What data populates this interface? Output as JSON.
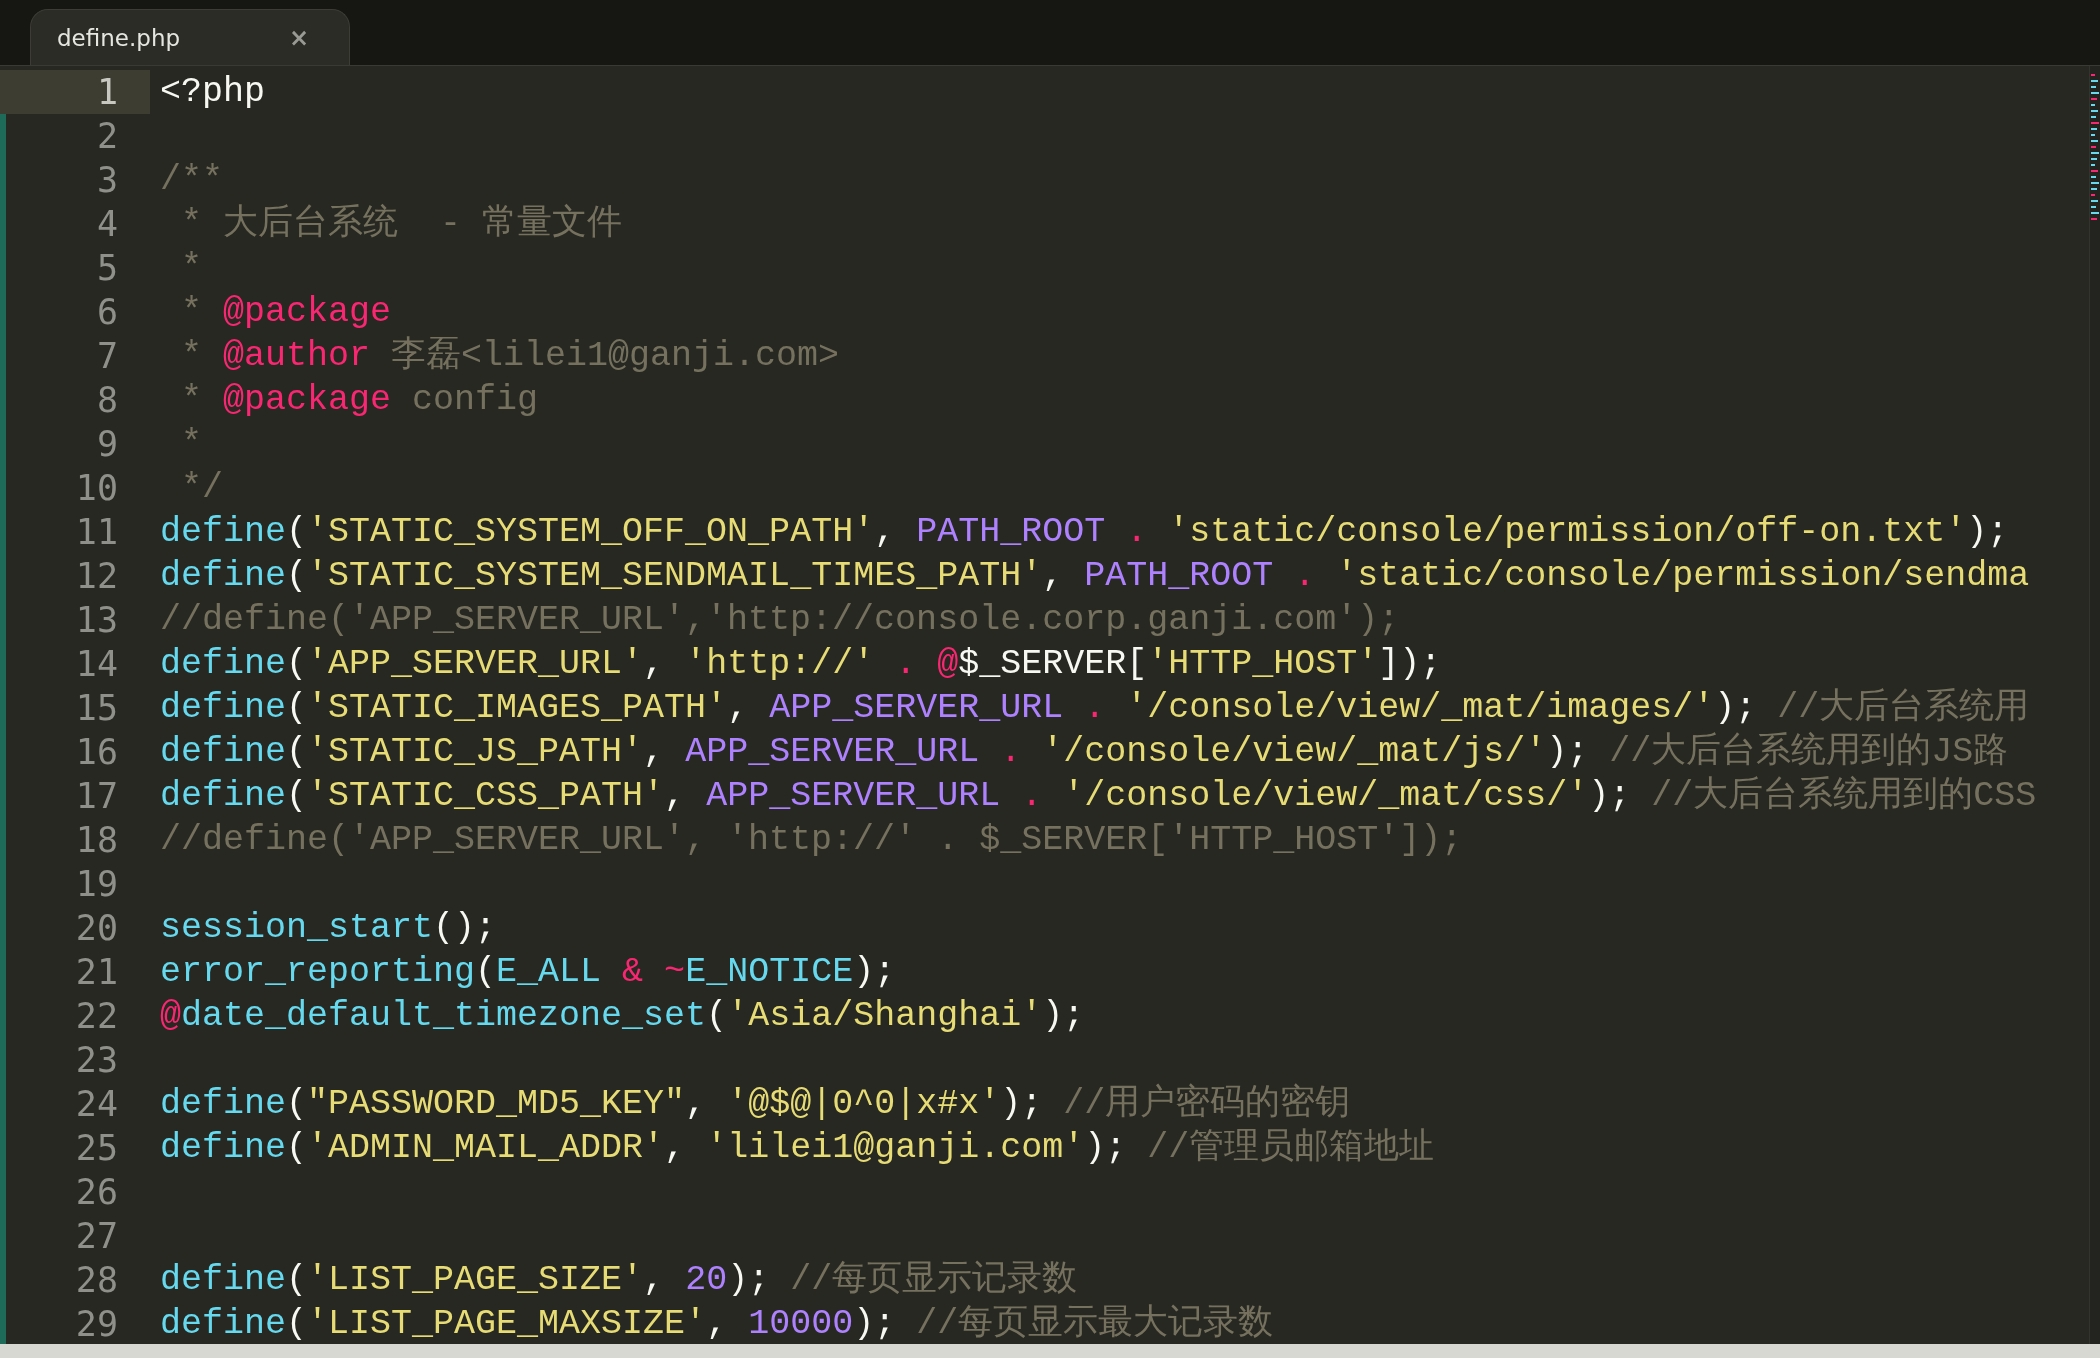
{
  "tab": {
    "title": "define.php",
    "close": "×",
    "selected": true
  },
  "lines": [
    {
      "number": "1",
      "current": true,
      "tokens": [
        {
          "kind": "plain",
          "text": "<?php"
        }
      ]
    },
    {
      "number": "2",
      "current": false
    },
    {
      "number": "3",
      "current": false,
      "tokens": [
        {
          "kind": "comment",
          "text": "/**"
        }
      ]
    },
    {
      "number": "4",
      "current": false,
      "tokens": [
        {
          "kind": "comment",
          "text": " * 大后台系统  - 常量文件"
        }
      ]
    },
    {
      "number": "5",
      "current": false,
      "tokens": [
        {
          "kind": "comment",
          "text": " *"
        }
      ]
    },
    {
      "number": "6",
      "current": false,
      "tokens": [
        {
          "kind": "comment",
          "text": " * "
        },
        {
          "kind": "operator",
          "text": "@package"
        }
      ]
    },
    {
      "number": "7",
      "current": false,
      "tokens": [
        {
          "kind": "comment",
          "text": " * "
        },
        {
          "kind": "operator",
          "text": "@author"
        },
        {
          "kind": "comment",
          "text": " 李磊<lilei1@ganji.com>"
        }
      ]
    },
    {
      "number": "8",
      "current": false,
      "tokens": [
        {
          "kind": "comment",
          "text": " * "
        },
        {
          "kind": "operator",
          "text": "@package"
        },
        {
          "kind": "comment",
          "text": " config"
        }
      ]
    },
    {
      "number": "9",
      "current": false,
      "tokens": [
        {
          "kind": "comment",
          "text": " *"
        }
      ]
    },
    {
      "number": "10",
      "current": false,
      "tokens": [
        {
          "kind": "comment",
          "text": " */"
        }
      ]
    },
    {
      "number": "11",
      "current": false,
      "tokens": [
        {
          "kind": "function",
          "text": "define"
        },
        {
          "kind": "plain",
          "text": "("
        },
        {
          "kind": "string",
          "text": "'STATIC_SYSTEM_OFF_ON_PATH'"
        },
        {
          "kind": "plain",
          "text": ", "
        },
        {
          "kind": "constant",
          "text": "PATH_ROOT"
        },
        {
          "kind": "operator",
          "text": " . "
        },
        {
          "kind": "string",
          "text": "'static/console/permission/off-on.txt'"
        },
        {
          "kind": "plain",
          "text": ");"
        }
      ]
    },
    {
      "number": "12",
      "current": false,
      "tokens": [
        {
          "kind": "function",
          "text": "define"
        },
        {
          "kind": "plain",
          "text": "("
        },
        {
          "kind": "string",
          "text": "'STATIC_SYSTEM_SENDMAIL_TIMES_PATH'"
        },
        {
          "kind": "plain",
          "text": ", "
        },
        {
          "kind": "constant",
          "text": "PATH_ROOT"
        },
        {
          "kind": "operator",
          "text": " . "
        },
        {
          "kind": "string",
          "text": "'static/console/permission/sendma"
        }
      ]
    },
    {
      "number": "13",
      "current": false,
      "tokens": [
        {
          "kind": "comment",
          "text": "//define('APP_SERVER_URL','http://console.corp.ganji.com');"
        }
      ]
    },
    {
      "number": "14",
      "current": false,
      "tokens": [
        {
          "kind": "function",
          "text": "define"
        },
        {
          "kind": "plain",
          "text": "("
        },
        {
          "kind": "string",
          "text": "'APP_SERVER_URL'"
        },
        {
          "kind": "plain",
          "text": ", "
        },
        {
          "kind": "string",
          "text": "'http://'"
        },
        {
          "kind": "operator",
          "text": " . @"
        },
        {
          "kind": "plain",
          "text": "$_SERVER["
        },
        {
          "kind": "string",
          "text": "'HTTP_HOST'"
        },
        {
          "kind": "plain",
          "text": "]);"
        }
      ]
    },
    {
      "number": "15",
      "current": false,
      "tokens": [
        {
          "kind": "function",
          "text": "define"
        },
        {
          "kind": "plain",
          "text": "("
        },
        {
          "kind": "string",
          "text": "'STATIC_IMAGES_PATH'"
        },
        {
          "kind": "plain",
          "text": ", "
        },
        {
          "kind": "constant",
          "text": "APP_SERVER_URL"
        },
        {
          "kind": "operator",
          "text": " . "
        },
        {
          "kind": "string",
          "text": "'/console/view/_mat/images/'"
        },
        {
          "kind": "plain",
          "text": "); "
        },
        {
          "kind": "comment",
          "text": "//大后台系统用"
        }
      ]
    },
    {
      "number": "16",
      "current": false,
      "tokens": [
        {
          "kind": "function",
          "text": "define"
        },
        {
          "kind": "plain",
          "text": "("
        },
        {
          "kind": "string",
          "text": "'STATIC_JS_PATH'"
        },
        {
          "kind": "plain",
          "text": ", "
        },
        {
          "kind": "constant",
          "text": "APP_SERVER_URL"
        },
        {
          "kind": "operator",
          "text": " . "
        },
        {
          "kind": "string",
          "text": "'/console/view/_mat/js/'"
        },
        {
          "kind": "plain",
          "text": "); "
        },
        {
          "kind": "comment",
          "text": "//大后台系统用到的JS路"
        }
      ]
    },
    {
      "number": "17",
      "current": false,
      "tokens": [
        {
          "kind": "function",
          "text": "define"
        },
        {
          "kind": "plain",
          "text": "("
        },
        {
          "kind": "string",
          "text": "'STATIC_CSS_PATH'"
        },
        {
          "kind": "plain",
          "text": ", "
        },
        {
          "kind": "constant",
          "text": "APP_SERVER_URL"
        },
        {
          "kind": "operator",
          "text": " . "
        },
        {
          "kind": "string",
          "text": "'/console/view/_mat/css/'"
        },
        {
          "kind": "plain",
          "text": "); "
        },
        {
          "kind": "comment",
          "text": "//大后台系统用到的CSS"
        }
      ]
    },
    {
      "number": "18",
      "current": false,
      "tokens": [
        {
          "kind": "comment",
          "text": "//define('APP_SERVER_URL', 'http://' . $_SERVER['HTTP_HOST']);"
        }
      ]
    },
    {
      "number": "19",
      "current": false
    },
    {
      "number": "20",
      "current": false,
      "tokens": [
        {
          "kind": "function",
          "text": "session_start"
        },
        {
          "kind": "plain",
          "text": "();"
        }
      ]
    },
    {
      "number": "21",
      "current": false,
      "tokens": [
        {
          "kind": "function",
          "text": "error_reporting"
        },
        {
          "kind": "plain",
          "text": "("
        },
        {
          "kind": "function",
          "text": "E_ALL"
        },
        {
          "kind": "operator",
          "text": " & ~"
        },
        {
          "kind": "function",
          "text": "E_NOTICE"
        },
        {
          "kind": "plain",
          "text": ");"
        }
      ]
    },
    {
      "number": "22",
      "current": false,
      "tokens": [
        {
          "kind": "operator",
          "text": "@"
        },
        {
          "kind": "function",
          "text": "date_default_timezone_set"
        },
        {
          "kind": "plain",
          "text": "("
        },
        {
          "kind": "string",
          "text": "'Asia/Shanghai'"
        },
        {
          "kind": "plain",
          "text": ");"
        }
      ]
    },
    {
      "number": "23",
      "current": false
    },
    {
      "number": "24",
      "current": false,
      "tokens": [
        {
          "kind": "function",
          "text": "define"
        },
        {
          "kind": "plain",
          "text": "("
        },
        {
          "kind": "string",
          "text": "\"PASSWORD_MD5_KEY\""
        },
        {
          "kind": "plain",
          "text": ", "
        },
        {
          "kind": "string",
          "text": "'@$@|0^0|x#x'"
        },
        {
          "kind": "plain",
          "text": "); "
        },
        {
          "kind": "comment",
          "text": "//用户密码的密钥"
        }
      ]
    },
    {
      "number": "25",
      "current": false,
      "tokens": [
        {
          "kind": "function",
          "text": "define"
        },
        {
          "kind": "plain",
          "text": "("
        },
        {
          "kind": "string",
          "text": "'ADMIN_MAIL_ADDR'"
        },
        {
          "kind": "plain",
          "text": ", "
        },
        {
          "kind": "string",
          "text": "'lilei1@ganji.com'"
        },
        {
          "kind": "plain",
          "text": "); "
        },
        {
          "kind": "comment",
          "text": "//管理员邮箱地址"
        }
      ]
    },
    {
      "number": "26",
      "current": false
    },
    {
      "number": "27",
      "current": false
    },
    {
      "number": "28",
      "current": false,
      "tokens": [
        {
          "kind": "function",
          "text": "define"
        },
        {
          "kind": "plain",
          "text": "("
        },
        {
          "kind": "string",
          "text": "'LIST_PAGE_SIZE'"
        },
        {
          "kind": "plain",
          "text": ", "
        },
        {
          "kind": "constant",
          "text": "20"
        },
        {
          "kind": "plain",
          "text": "); "
        },
        {
          "kind": "comment",
          "text": "//每页显示记录数"
        }
      ]
    },
    {
      "number": "29",
      "current": false,
      "tokens": [
        {
          "kind": "function",
          "text": "define"
        },
        {
          "kind": "plain",
          "text": "("
        },
        {
          "kind": "string",
          "text": "'LIST_PAGE_MAXSIZE'"
        },
        {
          "kind": "plain",
          "text": ", "
        },
        {
          "kind": "constant",
          "text": "10000"
        },
        {
          "kind": "plain",
          "text": "); "
        },
        {
          "kind": "comment",
          "text": "//每页显示最大记录数"
        }
      ]
    }
  ]
}
